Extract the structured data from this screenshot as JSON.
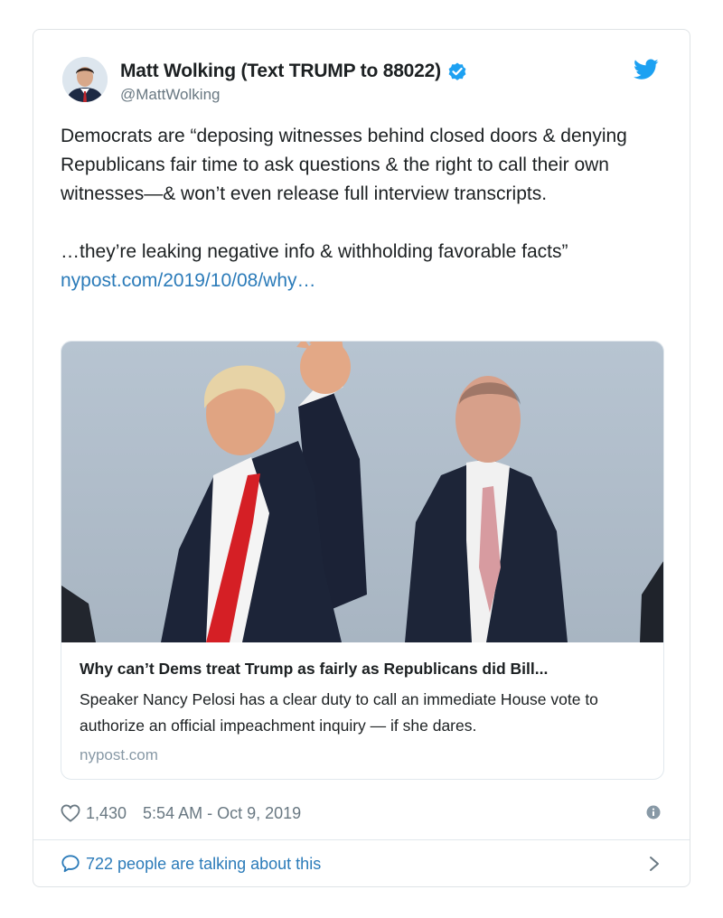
{
  "author": {
    "display_name": "Matt Wolking (Text TRUMP to 88022)",
    "handle": "@MattWolking",
    "verified": true
  },
  "tweet": {
    "paragraph_1": "Democrats are “deposing witnesses behind closed doors & denying Republicans fair time to ask questions & the right to call their own witnesses—& won’t even release full interview transcripts.",
    "paragraph_2": "…they’re leaking negative info & withholding favorable facts”",
    "link_text": "nypost.com/2019/10/08/why…"
  },
  "link_card": {
    "title": "Why can’t Dems treat Trump as fairly as Republicans did Bill...",
    "description": "Speaker Nancy Pelosi has a clear duty to call an immediate House vote to authorize an official impeachment inquiry — if she dares.",
    "domain": "nypost.com"
  },
  "meta": {
    "likes": "1,430",
    "timestamp": "5:54 AM - Oct 9, 2019"
  },
  "talking": {
    "label": "722 people are talking about this"
  },
  "icons": {
    "twitter": "twitter-bird-icon",
    "verified": "verified-badge-icon",
    "like": "heart-icon",
    "info": "info-icon",
    "reply": "speech-bubble-icon",
    "chevron": "chevron-right-icon"
  },
  "colors": {
    "brand_blue": "#1da1f2",
    "link_blue": "#2b7bb9",
    "secondary_gray": "#697882",
    "border": "#e1e8ed"
  }
}
